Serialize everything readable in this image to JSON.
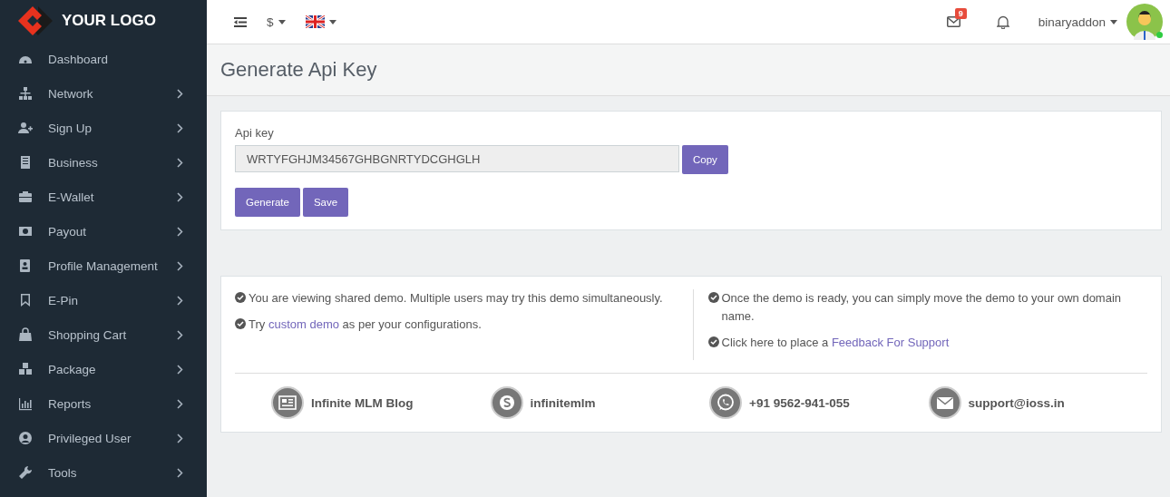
{
  "logo": {
    "text": "YOUR LOGO"
  },
  "sidebar": {
    "items": [
      {
        "label": "Dashboard",
        "kind": "dashboard",
        "expandable": false
      },
      {
        "label": "Network",
        "kind": "network",
        "expandable": true
      },
      {
        "label": "Sign Up",
        "kind": "signup",
        "expandable": true
      },
      {
        "label": "Business",
        "kind": "business",
        "expandable": true
      },
      {
        "label": "E-Wallet",
        "kind": "wallet",
        "expandable": true
      },
      {
        "label": "Payout",
        "kind": "payout",
        "expandable": true
      },
      {
        "label": "Profile Management",
        "kind": "profile",
        "expandable": true
      },
      {
        "label": "E-Pin",
        "kind": "epin",
        "expandable": true
      },
      {
        "label": "Shopping Cart",
        "kind": "cart",
        "expandable": true
      },
      {
        "label": "Package",
        "kind": "package",
        "expandable": true
      },
      {
        "label": "Reports",
        "kind": "reports",
        "expandable": true
      },
      {
        "label": "Privileged User",
        "kind": "user",
        "expandable": true
      },
      {
        "label": "Tools",
        "kind": "tools",
        "expandable": true
      }
    ]
  },
  "topbar": {
    "currency": "$",
    "mail_count": "9",
    "username": "binaryaddon",
    "online": true
  },
  "page_title": "Generate Api Key",
  "api_form": {
    "label": "Api key",
    "value": "WRTYFGHJM34567GHBGNRTYDCGHGLH",
    "copy_button": "Copy",
    "buttons": [
      "Generate",
      "Save"
    ]
  },
  "notes": {
    "left": [
      {
        "before": "You are viewing shared demo. Multiple users may try this demo simultaneously."
      },
      {
        "before": "Try ",
        "link": "custom demo",
        "after": " as per your configurations."
      }
    ],
    "right": [
      {
        "before": "Once the demo is ready, you can simply move the demo to your own domain name."
      },
      {
        "before": "Click here to place a ",
        "link": "Feedback For Support"
      }
    ]
  },
  "contacts": [
    {
      "kind": "blog",
      "text": "Infinite MLM Blog"
    },
    {
      "kind": "skype",
      "text": "infinitemlm"
    },
    {
      "kind": "whatsapp",
      "text": "+91 9562-941-055"
    },
    {
      "kind": "mail",
      "text": "support@ioss.in"
    }
  ]
}
